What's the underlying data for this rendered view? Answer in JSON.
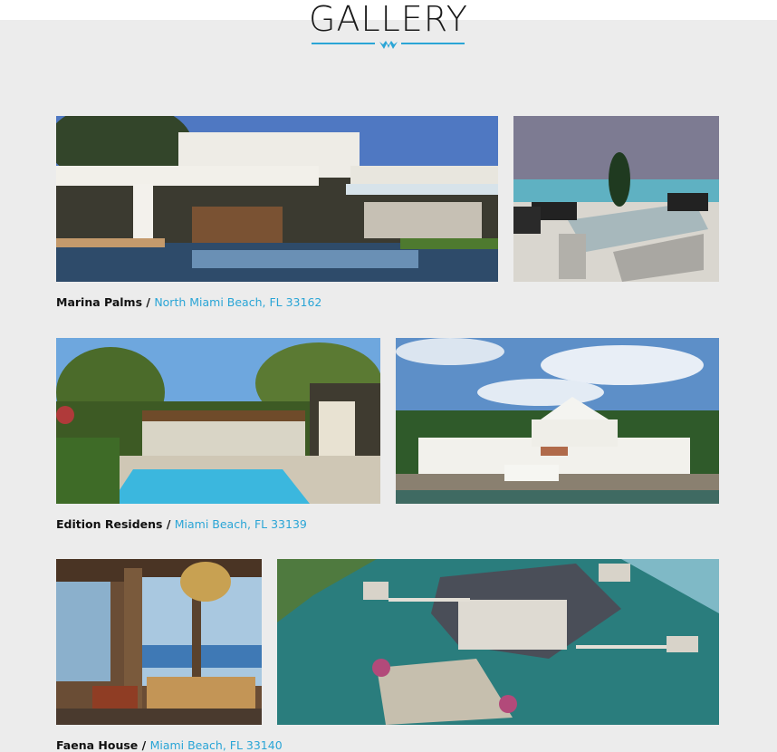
{
  "header": {
    "title": "GALLERY",
    "accent_color": "#2aa5d6",
    "logo_icon": "crown-logo-icon"
  },
  "gallery": [
    {
      "name": "Marina Palms",
      "separator": " / ",
      "location": "North Miami Beach, FL 33162",
      "photos": [
        "modern-villa-pool-photo",
        "terrace-dining-ocean-photo"
      ]
    },
    {
      "name": "Edition Residens",
      "separator": " / ",
      "location": "Miami Beach, FL 33139",
      "photos": [
        "palm-courtyard-pool-photo",
        "white-waterfront-mansion-photo"
      ]
    },
    {
      "name": "Faena House",
      "separator": " / ",
      "location": "Miami Beach, FL 33140",
      "photos": [
        "chandelier-living-room-photo",
        "aerial-island-chateau-photo"
      ]
    }
  ]
}
